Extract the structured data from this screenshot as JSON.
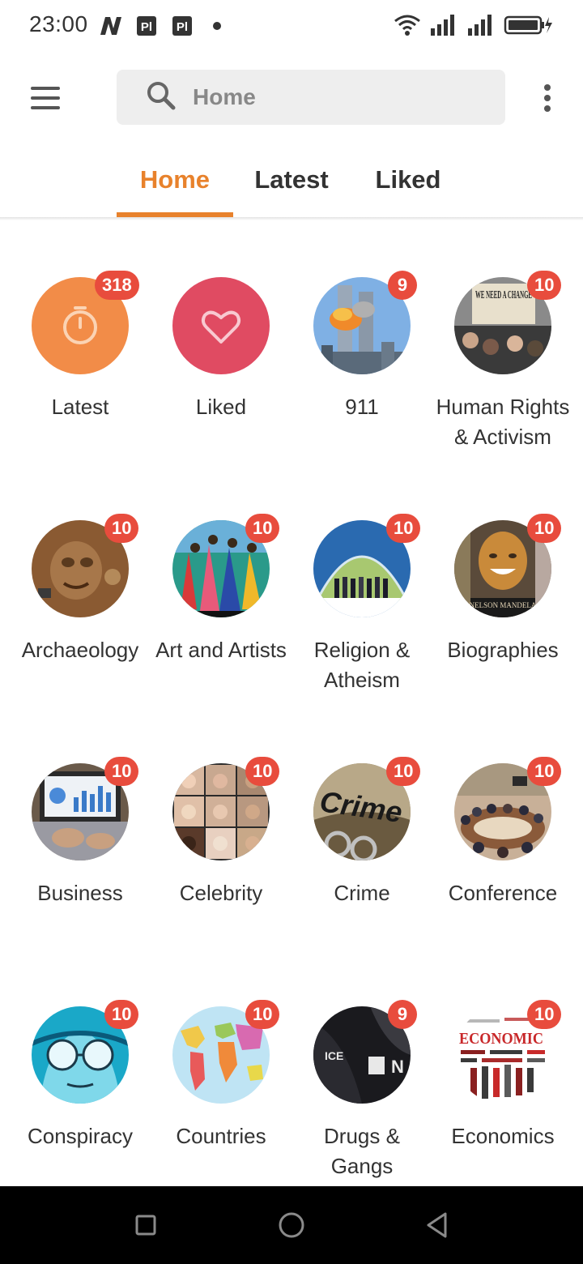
{
  "status_bar": {
    "time": "23:00",
    "notification_icons": [
      "news-n-icon",
      "pdf-icon",
      "pdf-icon",
      "dot-icon"
    ],
    "right_icons": [
      "wifi-icon",
      "signal-icon",
      "signal-icon",
      "battery-charging-icon"
    ]
  },
  "toolbar": {
    "search_placeholder": "Home",
    "menu_icon": "hamburger-menu-icon",
    "more_icon": "more-vertical-icon"
  },
  "tabs": [
    {
      "label": "Home",
      "active": true
    },
    {
      "label": "Latest",
      "active": false
    },
    {
      "label": "Liked",
      "active": false
    }
  ],
  "accent_color": "#e8822c",
  "badge_color": "#e84c3d",
  "categories": [
    {
      "label": "Latest",
      "badge": "318",
      "icon": "stopwatch-icon"
    },
    {
      "label": "Liked",
      "badge": "",
      "icon": "heart-icon"
    },
    {
      "label": "911",
      "badge": "9"
    },
    {
      "label": "Human Rights & Activism",
      "badge": "10"
    },
    {
      "label": "Archaeology",
      "badge": "10"
    },
    {
      "label": "Art and Artists",
      "badge": "10"
    },
    {
      "label": "Religion & Atheism",
      "badge": "10"
    },
    {
      "label": "Biographies",
      "badge": "10"
    },
    {
      "label": "Business",
      "badge": "10"
    },
    {
      "label": "Celebrity",
      "badge": "10"
    },
    {
      "label": "Crime",
      "badge": "10"
    },
    {
      "label": "Conference",
      "badge": "10"
    },
    {
      "label": "Conspiracy",
      "badge": "10"
    },
    {
      "label": "Countries",
      "badge": "10"
    },
    {
      "label": "Drugs & Gangs",
      "badge": "9"
    },
    {
      "label": "Economics",
      "badge": "10"
    }
  ],
  "thumbnail_text": {
    "human_rights_sign": "WE NEED A CHANGE",
    "biographies_book": "NELSON MANDELA",
    "crime_word": "Crime",
    "economics_word": "ECONOMIC"
  },
  "navbar": {
    "icons": [
      "recents-square-icon",
      "home-circle-icon",
      "back-triangle-icon"
    ]
  }
}
